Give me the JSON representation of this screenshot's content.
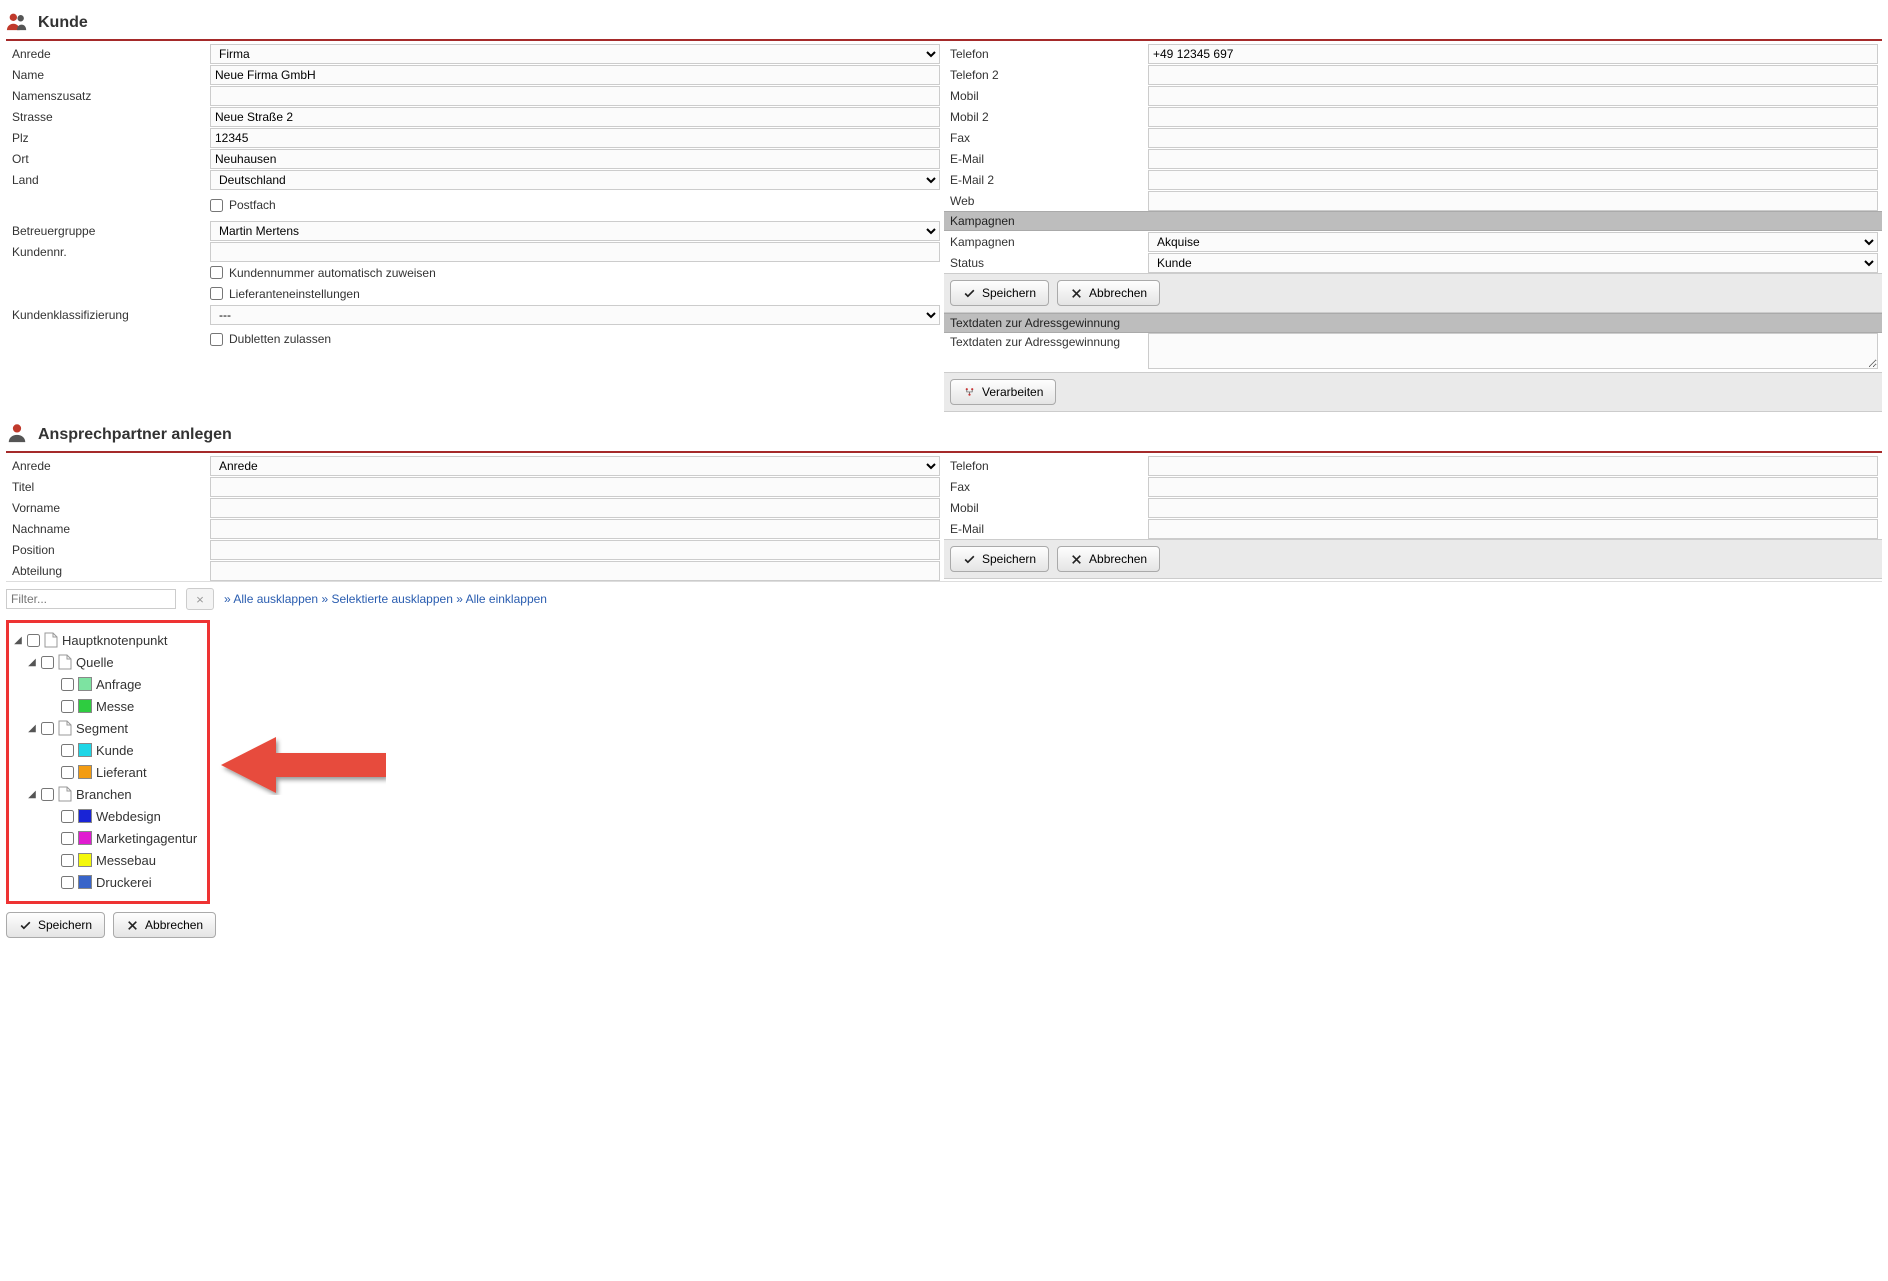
{
  "section1": {
    "title": "Kunde"
  },
  "customer": {
    "labels": {
      "anrede": "Anrede",
      "name": "Name",
      "namenszusatz": "Namenszusatz",
      "strasse": "Strasse",
      "plz": "Plz",
      "ort": "Ort",
      "land": "Land",
      "postfach": "Postfach",
      "betreuergruppe": "Betreuergruppe",
      "kundennr": "Kundennr.",
      "auto_kundennr": "Kundennummer automatisch zuweisen",
      "lieferanteneinst": "Lieferanteneinstellungen",
      "klass": "Kundenklassifizierung",
      "dubletten": "Dubletten zulassen"
    },
    "values": {
      "anrede": "Firma",
      "name": "Neue Firma GmbH",
      "namenszusatz": "",
      "strasse": "Neue Straße 2",
      "plz": "12345",
      "ort": "Neuhausen",
      "land": "Deutschland",
      "betreuergruppe": "Martin Mertens",
      "kundennr": "",
      "klass": "---"
    }
  },
  "contact": {
    "labels": {
      "telefon": "Telefon",
      "telefon2": "Telefon 2",
      "mobil": "Mobil",
      "mobil2": "Mobil 2",
      "fax": "Fax",
      "email": "E-Mail",
      "email2": "E-Mail 2",
      "web": "Web"
    },
    "values": {
      "telefon": "+49 12345 697",
      "telefon2": "",
      "mobil": "",
      "mobil2": "",
      "fax": "",
      "email": "",
      "email2": "",
      "web": ""
    }
  },
  "kampagnen": {
    "header": "Kampagnen",
    "labels": {
      "kampagnen": "Kampagnen",
      "status": "Status"
    },
    "values": {
      "kampagnen": "Akquise",
      "status": "Kunde"
    },
    "buttons": {
      "save": "Speichern",
      "cancel": "Abbrechen"
    }
  },
  "textdata": {
    "header": "Textdaten zur Adressgewinnung",
    "label": "Textdaten zur Adressgewinnung",
    "value": "",
    "button": "Verarbeiten"
  },
  "section2": {
    "title": "Ansprechpartner anlegen"
  },
  "ansprech": {
    "labels": {
      "anrede": "Anrede",
      "titel": "Titel",
      "vorname": "Vorname",
      "nachname": "Nachname",
      "position": "Position",
      "abteilung": "Abteilung"
    },
    "values": {
      "anrede": "Anrede",
      "titel": "",
      "vorname": "",
      "nachname": "",
      "position": "",
      "abteilung": ""
    },
    "right_labels": {
      "telefon": "Telefon",
      "fax": "Fax",
      "mobil": "Mobil",
      "email": "E-Mail"
    },
    "right_values": {
      "telefon": "",
      "fax": "",
      "mobil": "",
      "email": ""
    },
    "buttons": {
      "save": "Speichern",
      "cancel": "Abbrechen"
    }
  },
  "filter": {
    "placeholder": "Filter...",
    "links": {
      "expand_all": "Alle ausklappen",
      "expand_selected": "Selektierte ausklappen",
      "collapse_all": "Alle einklappen"
    }
  },
  "tree": {
    "root": "Hauptknotenpunkt",
    "quelle": {
      "label": "Quelle",
      "items": [
        {
          "label": "Anfrage",
          "color": "#7de3a1"
        },
        {
          "label": "Messe",
          "color": "#2ecc40"
        }
      ]
    },
    "segment": {
      "label": "Segment",
      "items": [
        {
          "label": "Kunde",
          "color": "#1fd6e6"
        },
        {
          "label": "Lieferant",
          "color": "#f39c12"
        }
      ]
    },
    "branchen": {
      "label": "Branchen",
      "items": [
        {
          "label": "Webdesign",
          "color": "#1924d6"
        },
        {
          "label": "Marketingagentur",
          "color": "#e01bd0"
        },
        {
          "label": "Messebau",
          "color": "#f4f80b"
        },
        {
          "label": "Druckerei",
          "color": "#3864c9"
        }
      ]
    }
  },
  "footer": {
    "save": "Speichern",
    "cancel": "Abbrechen"
  }
}
